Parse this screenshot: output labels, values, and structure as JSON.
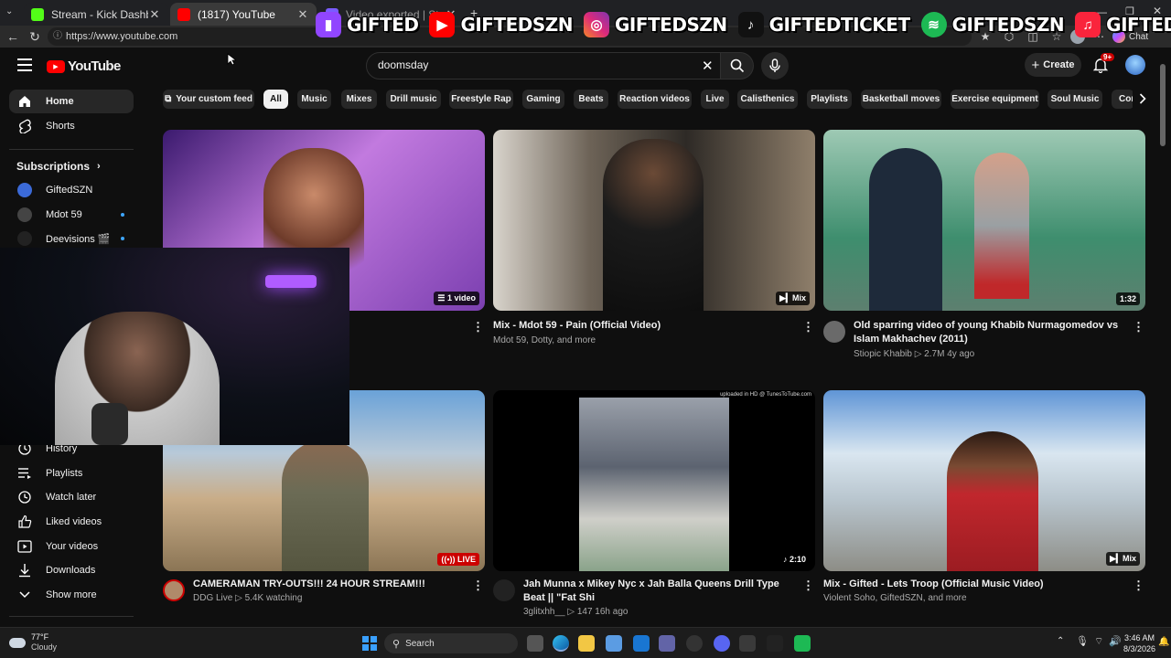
{
  "browser": {
    "tabs": [
      {
        "label": "Stream - Kick Dashboard",
        "active": false
      },
      {
        "label": "(1817) YouTube",
        "active": true
      },
      {
        "label": "Video exported | StreamLadder",
        "active": false
      }
    ],
    "url": "https://www.youtube.com",
    "copilot_label": "Chat"
  },
  "overlay": {
    "items": [
      {
        "icon": "twitch-icon",
        "text": "GIFTED",
        "color": "#9146ff"
      },
      {
        "icon": "youtube-icon",
        "text": "GIFTEDSZN",
        "color": "#ff0000"
      },
      {
        "icon": "instagram-icon",
        "text": "GIFTEDSZN",
        "color": "#e1306c"
      },
      {
        "icon": "tiktok-icon",
        "text": "GIFTEDTICKET",
        "color": "#111111"
      },
      {
        "icon": "spotify-icon",
        "text": "GIFTEDSZN",
        "color": "#1db954"
      },
      {
        "icon": "apple-music-icon",
        "text": "GIFTEDSZN",
        "color": "#fa243c"
      }
    ]
  },
  "youtube": {
    "logo_text": "YouTube",
    "search_value": "doomsday",
    "create_label": "Create",
    "notif_count": "9+",
    "sidebar": {
      "top": [
        {
          "label": "Home",
          "icon": "home-icon"
        },
        {
          "label": "Shorts",
          "icon": "shorts-icon"
        }
      ],
      "subscriptions_label": "Subscriptions",
      "subscriptions": [
        {
          "label": "GiftedSZN",
          "color": "#3b6ad8"
        },
        {
          "label": "Mdot 59",
          "color": "#444"
        },
        {
          "label": "Deevisions 🎬",
          "color": "#222"
        }
      ],
      "you": [
        {
          "label": "History",
          "icon": "history-icon"
        },
        {
          "label": "Playlists",
          "icon": "playlists-icon"
        },
        {
          "label": "Watch later",
          "icon": "watch-later-icon"
        },
        {
          "label": "Liked videos",
          "icon": "like-icon"
        },
        {
          "label": "Your videos",
          "icon": "your-videos-icon"
        },
        {
          "label": "Downloads",
          "icon": "download-icon"
        },
        {
          "label": "Show more",
          "icon": "chevron-down-icon"
        }
      ]
    },
    "chips": [
      "Your custom feed",
      "All",
      "Music",
      "Mixes",
      "Drill music",
      "Freestyle Rap",
      "Gaming",
      "Beats",
      "Reaction videos",
      "Live",
      "Calisthenics",
      "Playlists",
      "Basketball moves",
      "Exercise equipment",
      "Soul Music",
      "Con"
    ],
    "videos": [
      {
        "title": "",
        "meta": "",
        "badge": "1 video",
        "thumb_colors": [
          "#3b1a6e",
          "#c27adf",
          "#7b3fb0"
        ]
      },
      {
        "title": "Mix - Mdot 59 - Pain (Official Video)",
        "meta": "Mdot 59, Dotty, and more",
        "badge": "Mix",
        "thumb_colors": [
          "#5a5148",
          "#a89a88",
          "#2e2a26"
        ]
      },
      {
        "title": "Old sparring video of young Khabib Nurmagomedov vs Islam Makhachev (2011)",
        "meta": "Stiopic Khabib  ▷ 2.7M  4y ago",
        "badge": "1:32",
        "thumb_colors": [
          "#3e8e6e",
          "#6fb79a",
          "#2c6a52"
        ]
      },
      {
        "title": "CAMERAMAN TRY-OUTS!!! 24 HOUR STREAM!!!",
        "meta": "DDG Live  ▷ 5.4K watching",
        "badge": "LIVE",
        "thumb_colors": [
          "#6aa2d8",
          "#c9ad88",
          "#8b7555"
        ]
      },
      {
        "title": "Jah Munna x Mikey Nyc x Jah Balla Queens Drill Type Beat || \"Fat Shi",
        "meta": "3glitxhh__  ▷ 147  16h ago",
        "badge": "2:10",
        "thumb_colors": [
          "#000000",
          "#8d93a0",
          "#cfcfc9"
        ]
      },
      {
        "title": "Mix - Gifted - Lets Troop (Official Music Video)",
        "meta": "Violent Soho, GiftedSZN, and more",
        "badge": "Mix",
        "thumb_colors": [
          "#5f95d6",
          "#b9c6cf",
          "#c1272d"
        ]
      }
    ],
    "thumb_caption": "uploaded in HD @ TunesToTube.com"
  },
  "taskbar": {
    "weather_temp": "77°F",
    "weather_desc": "Cloudy",
    "search_label": "Search",
    "time": "3:46 AM",
    "date": "8/3/2026"
  }
}
